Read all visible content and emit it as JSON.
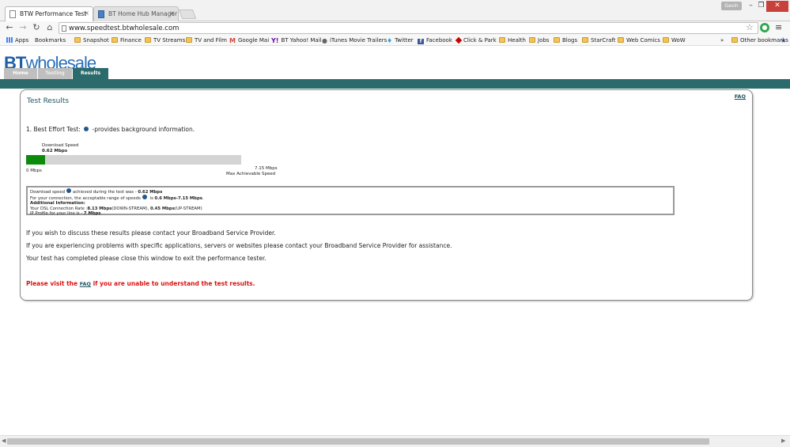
{
  "browser": {
    "tabs": [
      {
        "title": "BTW Performance Test",
        "close": "×"
      },
      {
        "title": "BT Home Hub Manager -",
        "close": "×"
      }
    ],
    "profile": "Gavin",
    "window": {
      "min": "–",
      "max": "❐",
      "close": "✕"
    },
    "nav": {
      "back": "←",
      "forward": "→",
      "reload": "↻",
      "home": "⌂"
    },
    "url": "www.speedtest.btwholesale.com",
    "star": "☆",
    "menu": "≡",
    "bookmarks": [
      {
        "label": "Apps",
        "icon": "apps-icon"
      },
      {
        "label": "Bookmarks",
        "icon": "star-icon"
      },
      {
        "label": "Snapshot",
        "icon": "folder-icon"
      },
      {
        "label": "Finance",
        "icon": "folder-icon"
      },
      {
        "label": "TV Streams",
        "icon": "folder-icon"
      },
      {
        "label": "TV and Film",
        "icon": "folder-icon"
      },
      {
        "label": "Google Mai",
        "icon": "gmail-icon"
      },
      {
        "label": "BT Yahoo! Mail",
        "icon": "yahoo-icon"
      },
      {
        "label": "iTunes Movie Trailers",
        "icon": "apple-icon"
      },
      {
        "label": "Twitter",
        "icon": "twitter-icon"
      },
      {
        "label": "Facebook",
        "icon": "facebook-icon"
      },
      {
        "label": "Click & Park",
        "icon": "clickpark-icon"
      },
      {
        "label": "Health",
        "icon": "folder-icon"
      },
      {
        "label": "Jobs",
        "icon": "folder-icon"
      },
      {
        "label": "Blogs",
        "icon": "folder-icon"
      },
      {
        "label": "StarCraft",
        "icon": "folder-icon"
      },
      {
        "label": "Web Comics",
        "icon": "folder-icon"
      },
      {
        "label": "WoW",
        "icon": "folder-icon"
      }
    ],
    "overflow": "»",
    "other_bookmarks": "Other bookmarks"
  },
  "site": {
    "logo_bt": "BT",
    "logo_rest": "wholesale",
    "nav": [
      "Home",
      "Testing",
      "Results"
    ],
    "panel_title": "Test Results",
    "faq": "FAQ",
    "best_effort_prefix": "1. Best Effort Test:",
    "best_effort_suffix": "-provides background information.",
    "download_label": "Download  Speed",
    "download_value": "0.62 Mbps",
    "download_fraction": 0.0867,
    "bar_min": "0 Mbps",
    "bar_max": "7.15 Mbps",
    "bar_max_label": "Max Achievable Speed",
    "details": {
      "l1_a": "Download speed",
      "l1_b": "achieved during the test was - ",
      "l1_val": "0.62 Mbps",
      "l2_a": "For your connection, the acceptable range of speeds",
      "l2_b": " is ",
      "l2_val": "0.6 Mbps-7.15 Mbps",
      "l2_end": ".",
      "l3": "Additional Information:",
      "l4_a": "Your DSL Connection Rate :",
      "l4_down": "8.13 Mbps",
      "l4_b": "(DOWN-STREAM), ",
      "l4_up": "0.45 Mbps",
      "l4_c": "(UP-STREAM)",
      "l5_a": "IP Profile for your line is - ",
      "l5_val": "7 Mbps"
    },
    "p1": "If you wish to discuss these results please contact your Broadband Service Provider.",
    "p2": "If you are experiencing problems with specific applications, servers or websites please contact your Broadband Service Provider for assistance.",
    "p3": "Your test has completed please close this window to exit the performance tester.",
    "warn_a": "Please visit the ",
    "warn_link": "FAQ",
    "warn_b": " if you are unable to understand the test results."
  },
  "colors": {
    "brand": "#2a6fb8",
    "nav_bar": "#2b6b6b",
    "progress": "#0c8a0c",
    "warning": "#dd1111"
  }
}
